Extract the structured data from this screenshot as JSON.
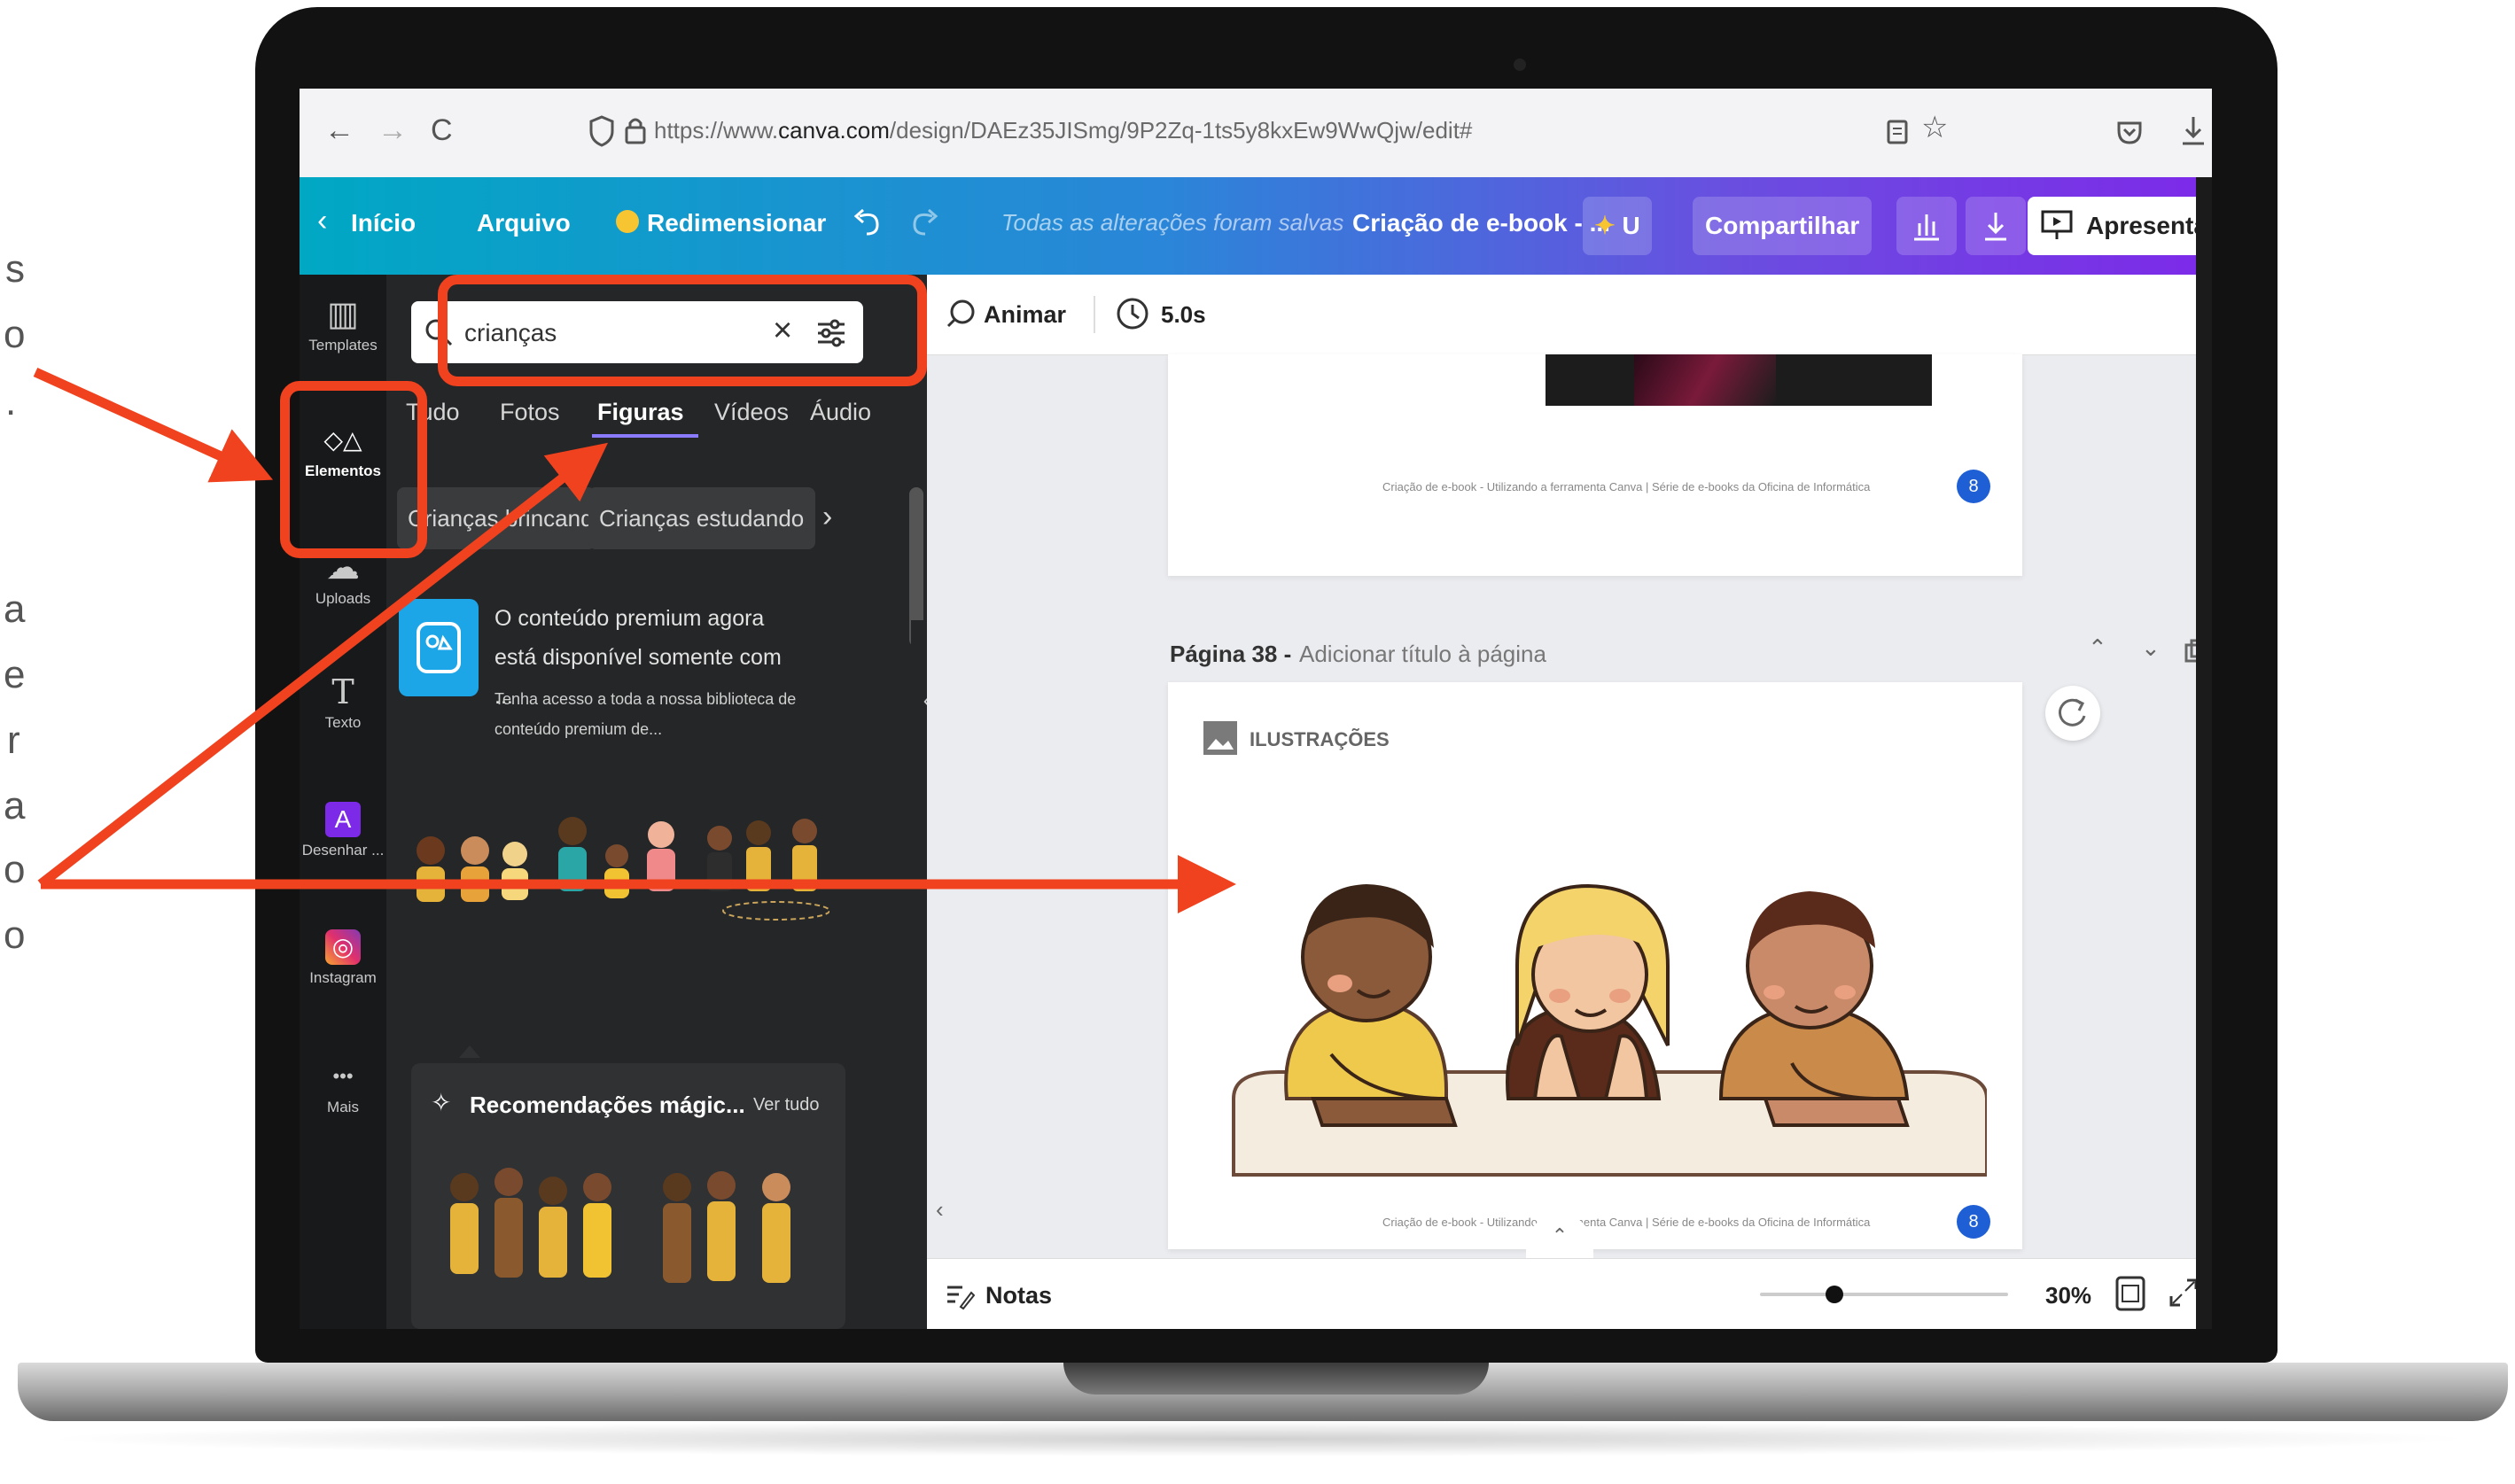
{
  "side_text_fragments": [
    "s",
    "o",
    ".",
    "a",
    "e",
    "r",
    "a",
    "o",
    "o"
  ],
  "browser": {
    "back_icon": "←",
    "forward_icon": "→",
    "reload_icon": "C",
    "url_prefix": "https://www.",
    "url_domain": "canva.com",
    "url_path": "/design/DAEz35JISmg/9P2Zq-1ts5y8kxEw9WwQjw/edit#"
  },
  "header": {
    "home_label": "Início",
    "file_label": "Arquivo",
    "resize_label": "Redimensionar",
    "saved_status": "Todas as alterações foram salvas",
    "design_title": "Criação de e-book - ...",
    "user_badge": "U",
    "share_label": "Compartilhar",
    "present_label": "Apresentar"
  },
  "rail": {
    "items": [
      {
        "label": "Templates",
        "icon": "▥"
      },
      {
        "label": "Elementos",
        "icon": "◇△"
      },
      {
        "label": "Uploads",
        "icon": "☁"
      },
      {
        "label": "Texto",
        "icon": "T"
      },
      {
        "label": "Desenhar ...",
        "icon": "A"
      },
      {
        "label": "Instagram",
        "icon": "◎"
      },
      {
        "label": "Mais",
        "icon": "•••"
      }
    ]
  },
  "panel": {
    "search_value": "crianças",
    "tabs": [
      "Tudo",
      "Fotos",
      "Figuras",
      "Vídeos",
      "Áudio"
    ],
    "active_tab": "Figuras",
    "chips": [
      "Crianças brincando",
      "Crianças estudando"
    ],
    "premium_title": "O conteúdo premium agora está disponível somente com ...",
    "premium_sub": "Tenha acesso a toda a nossa biblioteca de conteúdo premium de...",
    "magic_title": "Recomendações mágic...",
    "magic_link": "Ver tudo"
  },
  "toolbar": {
    "animate_label": "Animar",
    "duration": "5.0s"
  },
  "pages": {
    "page_label": "Página 38 -",
    "page_title_placeholder": "Adicionar título à página",
    "footer_text": "Criação de e-book - Utilizando a ferramenta Canva  |  Série de e-books da Oficina de Informática",
    "page_badge": "8",
    "section_label": "ILUSTRAÇÕES"
  },
  "bottom": {
    "notes_label": "Notas",
    "zoom": "30%",
    "zoom_fraction": 0.3
  },
  "colors": {
    "annotation_red": "#f0421e",
    "canva_gradient_start": "#00a8c4",
    "canva_gradient_end": "#7d2ae8"
  }
}
